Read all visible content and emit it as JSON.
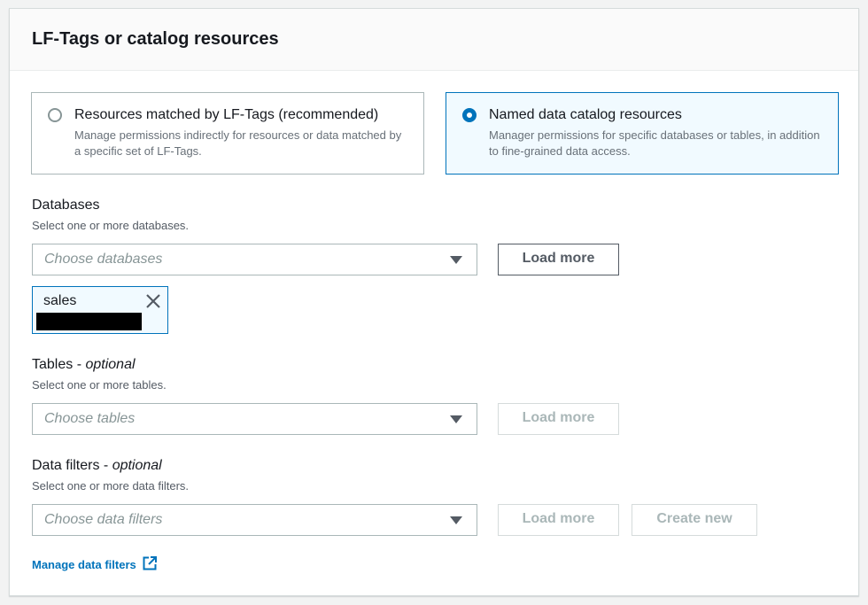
{
  "panel": {
    "title": "LF-Tags or catalog resources"
  },
  "tiles": [
    {
      "label": "Resources matched by LF-Tags (recommended)",
      "description": "Manage permissions indirectly for resources or data matched by a specific set of LF-Tags.",
      "selected": false
    },
    {
      "label": "Named data catalog resources",
      "description": "Manager permissions for specific databases or tables, in addition to fine-grained data access.",
      "selected": true
    }
  ],
  "databases": {
    "label": "Databases",
    "description": "Select one or more databases.",
    "placeholder": "Choose databases",
    "load_more": "Load more",
    "token": "sales"
  },
  "tables": {
    "label": "Tables",
    "optional": "optional",
    "description": "Select one or more tables.",
    "placeholder": "Choose tables",
    "load_more": "Load more"
  },
  "data_filters": {
    "label": "Data filters",
    "optional": "optional",
    "description": "Select one or more data filters.",
    "placeholder": "Choose data filters",
    "load_more": "Load more",
    "create_new": "Create new"
  },
  "manage_link": "Manage data filters",
  "icons": {
    "external": "external-link-icon",
    "caret": "caret-down-icon",
    "close": "close-icon"
  },
  "colors": {
    "accent": "#0073bb",
    "selected_bg": "#f1faff"
  }
}
